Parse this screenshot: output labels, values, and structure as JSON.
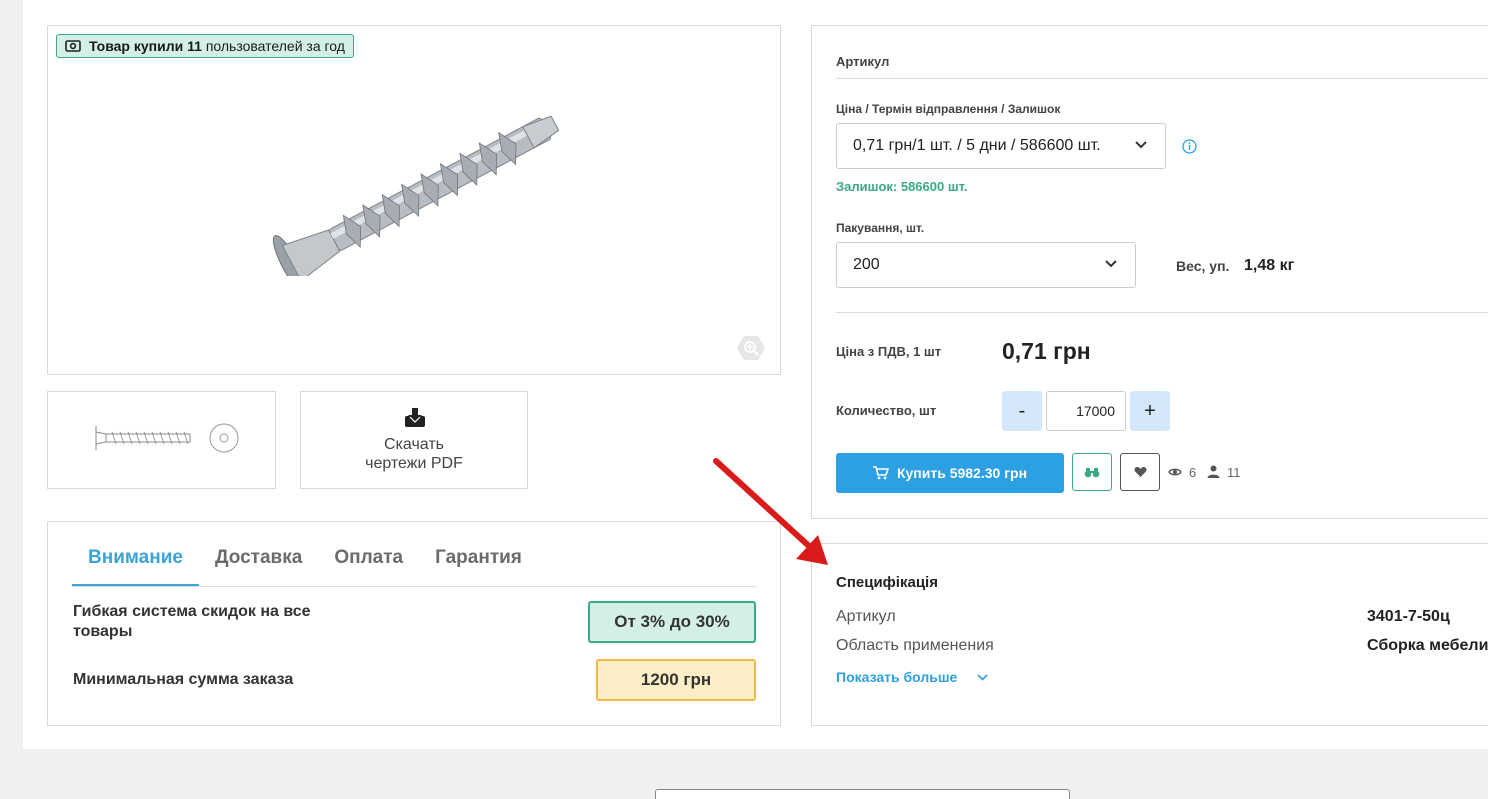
{
  "badge": {
    "prefix": "Товар купили",
    "count": "11",
    "suffix": "пользователей за год"
  },
  "pdf": {
    "line1": "Скачать",
    "line2": "чертежи PDF"
  },
  "tabs": [
    {
      "label": "Внимание"
    },
    {
      "label": "Доставка"
    },
    {
      "label": "Оплата"
    },
    {
      "label": "Гарантия"
    }
  ],
  "info": {
    "discount_label": "Гибкая система скидок на все товары",
    "discount_value": "От 3% до 30%",
    "min_label": "Минимальная сумма заказа",
    "min_value": "1200 грн"
  },
  "product": {
    "article_title": "Артикул",
    "price_select_label": "Ціна / Термін відправлення / Залишок",
    "price_select_value": "0,71 грн/1 шт. / 5 дни / 586600 шт.",
    "stock": "Залишок: 586600 шт.",
    "pack_label": "Пакування, шт.",
    "pack_value": "200",
    "weight_label": "Вес, уп.",
    "weight_value": "1,48 кг",
    "price_label": "Ціна з ПДВ, 1 шт",
    "price_value": "0,71 грн",
    "qty_label": "Количество, шт",
    "qty_minus": "-",
    "qty_value": "17000",
    "qty_plus": "+",
    "buy_label": "Купить 5982.30 грн",
    "views": "6",
    "buyers": "11"
  },
  "spec": {
    "title": "Специфікація",
    "rows": [
      {
        "key": "Артикул",
        "value": "3401-7-50ц"
      },
      {
        "key": "Область применения",
        "value": "Сборка мебели"
      }
    ],
    "more": "Показать больше"
  },
  "colors": {
    "accent": "#2d9fe3",
    "green": "#3aaa80",
    "arrow": "#d91b1b"
  }
}
